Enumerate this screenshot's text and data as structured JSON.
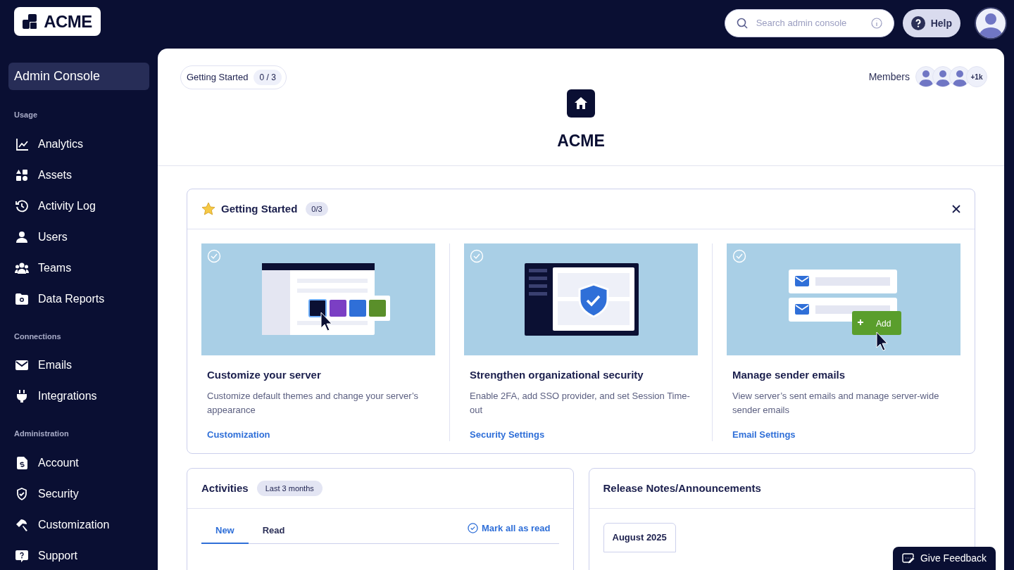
{
  "logo": {
    "text": "ACME"
  },
  "search": {
    "placeholder": "Search admin console"
  },
  "help": {
    "label": "Help"
  },
  "sidebar": {
    "title": "Admin Console",
    "sections": [
      {
        "heading": "Usage",
        "items": [
          {
            "label": "Analytics"
          },
          {
            "label": "Assets"
          },
          {
            "label": "Activity Log"
          },
          {
            "label": "Users"
          },
          {
            "label": "Teams"
          },
          {
            "label": "Data Reports"
          }
        ]
      },
      {
        "heading": "Connections",
        "items": [
          {
            "label": "Emails"
          },
          {
            "label": "Integrations"
          }
        ]
      },
      {
        "heading": "Administration",
        "items": [
          {
            "label": "Account"
          },
          {
            "label": "Security"
          },
          {
            "label": "Customization"
          },
          {
            "label": "Support"
          }
        ]
      }
    ]
  },
  "header": {
    "chip": {
      "label": "Getting Started",
      "count": "0 / 3"
    },
    "members": {
      "label": "Members",
      "more": "+1k"
    },
    "org_name": "ACME"
  },
  "getting_started": {
    "title": "Getting Started",
    "count": "0/3",
    "cards": [
      {
        "title": "Customize your server",
        "description": "Customize default themes and change your server’s appearance",
        "link": "Customization",
        "checked": false
      },
      {
        "title": "Strengthen organizational security",
        "description": "Enable 2FA, add SSO provider, and set Session Time-out",
        "link": "Security Settings",
        "checked": false
      },
      {
        "title": "Manage sender emails",
        "description": "View server’s sent emails and manage server-wide sender emails",
        "link": "Email Settings",
        "checked": false,
        "illustration_button": "Add"
      }
    ]
  },
  "activities": {
    "title": "Activities",
    "range": "Last 3 months",
    "tabs": [
      {
        "label": "New",
        "selected": true
      },
      {
        "label": "Read",
        "selected": false
      }
    ],
    "mark_all": "Mark all as read"
  },
  "release_notes": {
    "title": "Release Notes/Announcements",
    "month": "August 2025"
  },
  "feedback": {
    "label": "Give Feedback"
  }
}
